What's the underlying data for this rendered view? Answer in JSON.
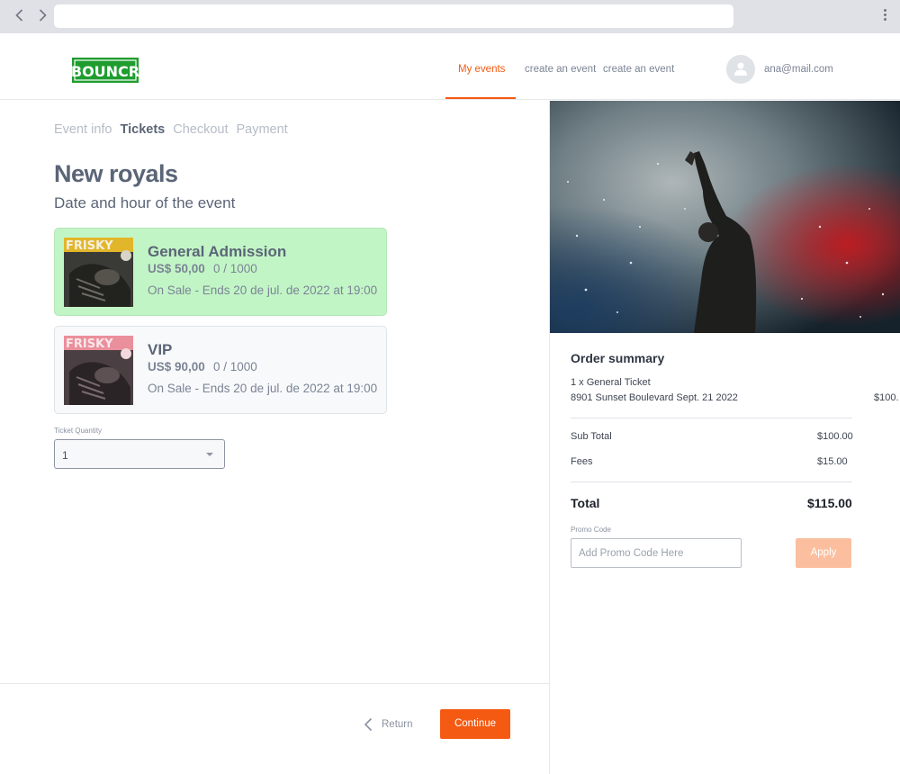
{
  "browser": {
    "url": "",
    "icons": {
      "back": "chevron-left-icon",
      "forward": "chevron-right-icon",
      "menu": "kebab-menu-icon"
    }
  },
  "header": {
    "logo_text": "BOUNCR",
    "nav": [
      {
        "label": "My events",
        "active": true
      },
      {
        "label": "create an event",
        "active": false
      },
      {
        "label": "create an event",
        "active": false
      }
    ],
    "user_email": "ana@mail.com",
    "accent_color": "#f45a12"
  },
  "steps": [
    {
      "label": "Event info",
      "current": false
    },
    {
      "label": "Tickets",
      "current": true
    },
    {
      "label": "Checkout",
      "current": false
    },
    {
      "label": "Payment",
      "current": false
    }
  ],
  "event": {
    "title": "New royals",
    "subtitle": "Date and hour of the event"
  },
  "tickets": [
    {
      "name": "General Admission",
      "price": "US$ 50,00",
      "count": "0 / 1000",
      "status": "On Sale - Ends 20 de jul. de 2022 at 19:00",
      "thumb_text": "FRISKY",
      "selected": true
    },
    {
      "name": "VIP",
      "price": "US$ 90,00",
      "count": "0 / 1000",
      "status": "On Sale - Ends 20 de jul. de 2022 at 19:00",
      "thumb_text": "FRISKY",
      "selected": false
    }
  ],
  "quantity": {
    "label": "Ticket Quantity",
    "value": "1"
  },
  "footer": {
    "return_label": "Return",
    "continue_label": "Continue"
  },
  "summary": {
    "title": "Order summary",
    "line_item": "1 x General Ticket",
    "location": "8901 Sunset Boulevard Sept. 21 2022",
    "line_amount": "$100.",
    "subtotal_label": "Sub Total",
    "subtotal_value": "$100.00",
    "fees_label": "Fees",
    "fees_value": "$15.00",
    "total_label": "Total",
    "total_value": "$115.00",
    "promo_label": "Promo Code",
    "promo_placeholder": "Add Promo Code Here",
    "apply_label": "Apply"
  }
}
